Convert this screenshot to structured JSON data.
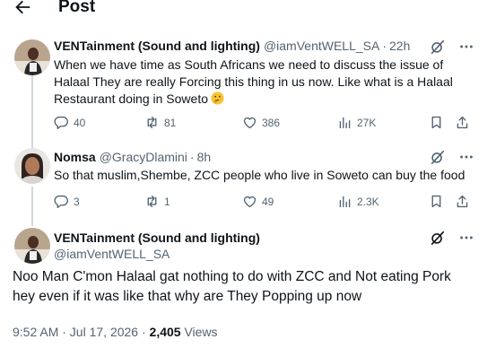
{
  "header": {
    "title": "Post"
  },
  "tweets": [
    {
      "name": "VENTainment (Sound and lighting)",
      "handle": "@iamVentWELL_SA",
      "dot": "·",
      "time": "22h",
      "text_line1": "When we have time as South Africans we need to discuss the issue of",
      "text_line2": "Halaal They are really Forcing this thing in us now. Like what is a Halaal",
      "text_line3": "Restaurant doing in Soweto",
      "emoji": "thinking-face-emoji",
      "replies": "40",
      "reposts": "81",
      "likes": "386",
      "views": "27K"
    },
    {
      "name": "Nomsa",
      "handle": "@GracyDlamini",
      "dot": "·",
      "time": "8h",
      "text_line1": "So that muslim,Shembe, ZCC people who live in Soweto can buy the food",
      "replies": "3",
      "reposts": "1",
      "likes": "49",
      "views": "2.3K"
    }
  ],
  "main": {
    "name": "VENTainment (Sound and lighting)",
    "handle": "@iamVentWELL_SA",
    "text_line1": "Noo Man C'mon Halaal gat nothing to do with ZCC and Not eating Pork",
    "text_line2": "hey even if it was like that why are They Popping up now",
    "timestamp": "9:52 AM · Jul 17, 2026 · ",
    "views_count": "2,405",
    "views_label": " Views"
  },
  "colors": {
    "text": "#0f1419",
    "secondary": "#536471",
    "thread_line": "#cfd9de"
  }
}
